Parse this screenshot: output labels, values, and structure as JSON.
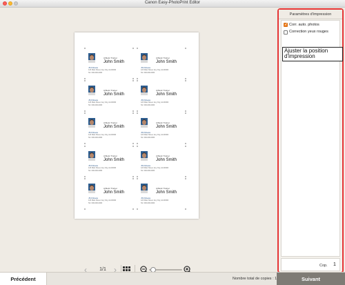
{
  "window": {
    "title": "Canon Easy-PhotoPrint Editor"
  },
  "card": {
    "job_title": "Athletic Trainer",
    "name": "John Smith",
    "company": "JS Fitness",
    "address": "123 Main Street, Any City, AA 00000",
    "phone": "Tel: 000-000-0000"
  },
  "navigation": {
    "page_indicator": "1/1"
  },
  "panel": {
    "title": "Paramètres d'impression",
    "auto_correct_label": "Corr. auto. photos",
    "auto_correct_checked": true,
    "redeye_label": "Correction yeux rouges",
    "redeye_checked": false,
    "adjust_button_label": "Ajuster la position d'impression",
    "copies_label": "Cop.",
    "copies_value": "1"
  },
  "footer": {
    "prev_label": "Précédent",
    "total_copies": "Nombre total de copies : 1",
    "next_label": "Suivant"
  },
  "colors": {
    "panel_border": "#e53333",
    "checkbox_accent": "#f08224",
    "next_button": "#7e7b75"
  }
}
